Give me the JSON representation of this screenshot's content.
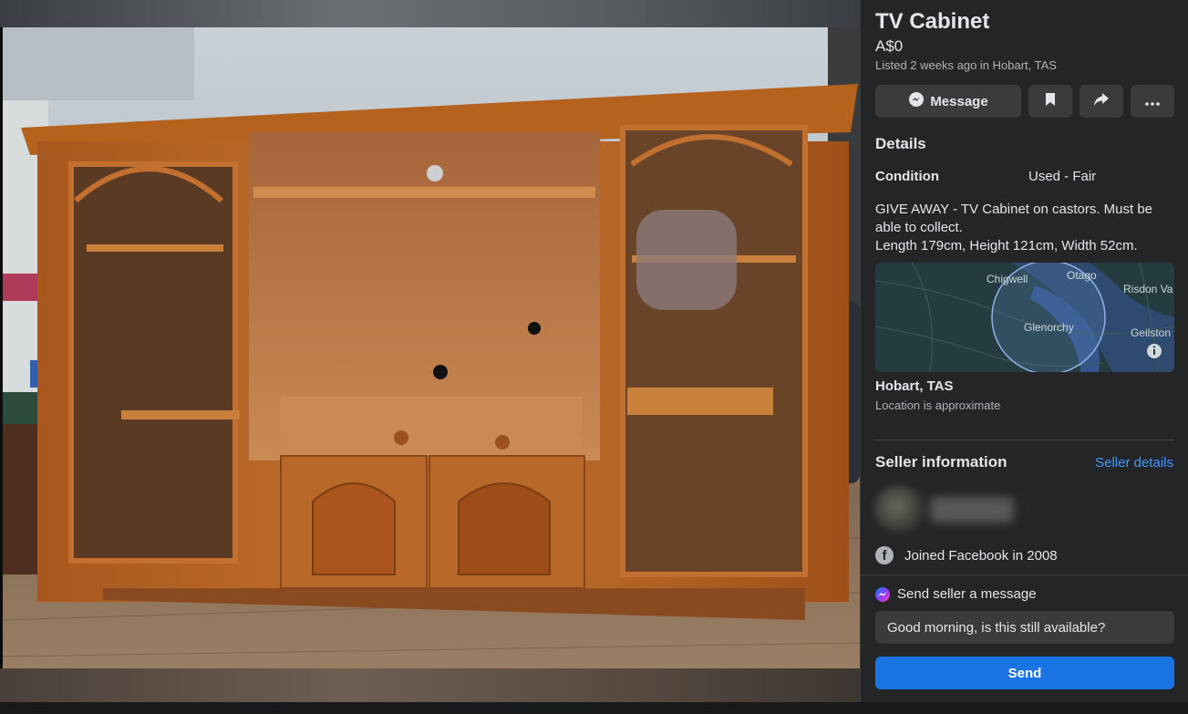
{
  "listing": {
    "title": "TV Cabinet",
    "price": "A$0",
    "listed": "Listed 2 weeks ago in Hobart, TAS"
  },
  "actions": {
    "message_label": "Message",
    "icons": [
      "messenger-icon",
      "bookmark-icon",
      "share-icon",
      "more-icon"
    ]
  },
  "details": {
    "heading": "Details",
    "condition_label": "Condition",
    "condition_value": "Used - Fair",
    "description_lines": [
      "GIVE AWAY - TV Cabinet on castors. Must be",
      "able to collect.",
      "Length 179cm, Height 121cm, Width 52cm."
    ]
  },
  "map": {
    "labels": [
      "Chigwell",
      "Otago",
      "Risdon Va",
      "Glenorchy",
      "Geilston"
    ]
  },
  "location": {
    "title": "Hobart, TAS",
    "subtitle": "Location is approximate"
  },
  "seller": {
    "heading": "Seller information",
    "details_link": "Seller details",
    "joined": "Joined Facebook in 2008"
  },
  "message_box": {
    "label": "Send seller a message",
    "value": "Good morning, is this still available?",
    "send_label": "Send"
  },
  "colors": {
    "panel_bg": "#242526",
    "accent": "#1b74e4",
    "link": "#4599ff"
  }
}
